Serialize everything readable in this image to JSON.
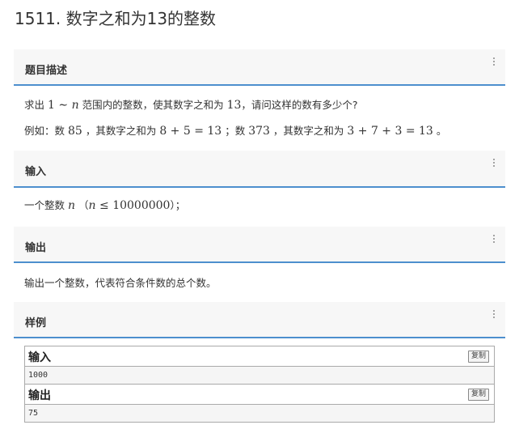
{
  "page": {
    "title": "1511. 数字之和为13的整数"
  },
  "sections": {
    "description": {
      "title": "题目描述",
      "line1": {
        "pre": "求出",
        "a": "1",
        "tilde": " ∼ ",
        "n": "n",
        "post": "范围内的整数，使其数字之和为",
        "num": "13",
        "end": "，请问这样的数有多少个?"
      },
      "line2": {
        "pre": "例如：数",
        "n1": "85",
        "mid1": "，其数字之和为",
        "expr1": "8 + 5 = 13",
        "mid2": "；数",
        "n2": "373",
        "mid3": "，其数字之和为",
        "expr2": "3 + 7 + 3 = 13",
        "end": "。"
      }
    },
    "input": {
      "title": "输入",
      "line": {
        "pre": "一个整数",
        "n": "n",
        "open": "（",
        "n2": "n",
        "leq": " ≤ ",
        "max": "10000000",
        "close": "）；"
      }
    },
    "output": {
      "title": "输出",
      "text": "输出一个整数，代表符合条件数的总个数。"
    },
    "sample": {
      "title": "样例",
      "input_label": "输入",
      "input_value": "1000",
      "output_label": "输出",
      "output_value": "75",
      "copy_label": "复制"
    }
  }
}
